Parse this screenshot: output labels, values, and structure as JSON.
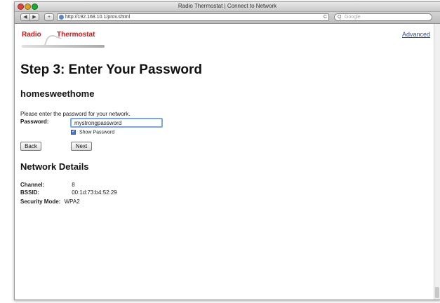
{
  "window": {
    "title": "Radio Thermostat | Connect to Network"
  },
  "toolbar": {
    "url": "http://192.168.10.1/prov.shtml",
    "search_placeholder": "Google",
    "back_glyph": "◀",
    "forward_glyph": "▶",
    "add_glyph": "+",
    "reload_glyph": "C",
    "search_glyph": "Q"
  },
  "header": {
    "logo_word1": "Radio",
    "logo_word2": "Thermostat",
    "advanced_link": "Advanced"
  },
  "main": {
    "step_title": "Step 3: Enter Your Password",
    "network_name": "homesweethome",
    "prompt": "Please enter the password for your network.",
    "password_label": "Password:",
    "password_value": "mystrongpassword",
    "show_password_label": "Show Password",
    "back_button": "Back",
    "next_button": "Next"
  },
  "details": {
    "title": "Network Details",
    "channel_label": "Channel:",
    "channel_value": "8",
    "bssid_label": "BSSID:",
    "bssid_value": "00:1d:73:b4:52:29",
    "security_label": "Security Mode:",
    "security_value": "WPA2"
  },
  "colors": {
    "logo_red": "#e01010",
    "link_blue": "#2b4ea8",
    "focus_blue": "#7aa7e0"
  }
}
